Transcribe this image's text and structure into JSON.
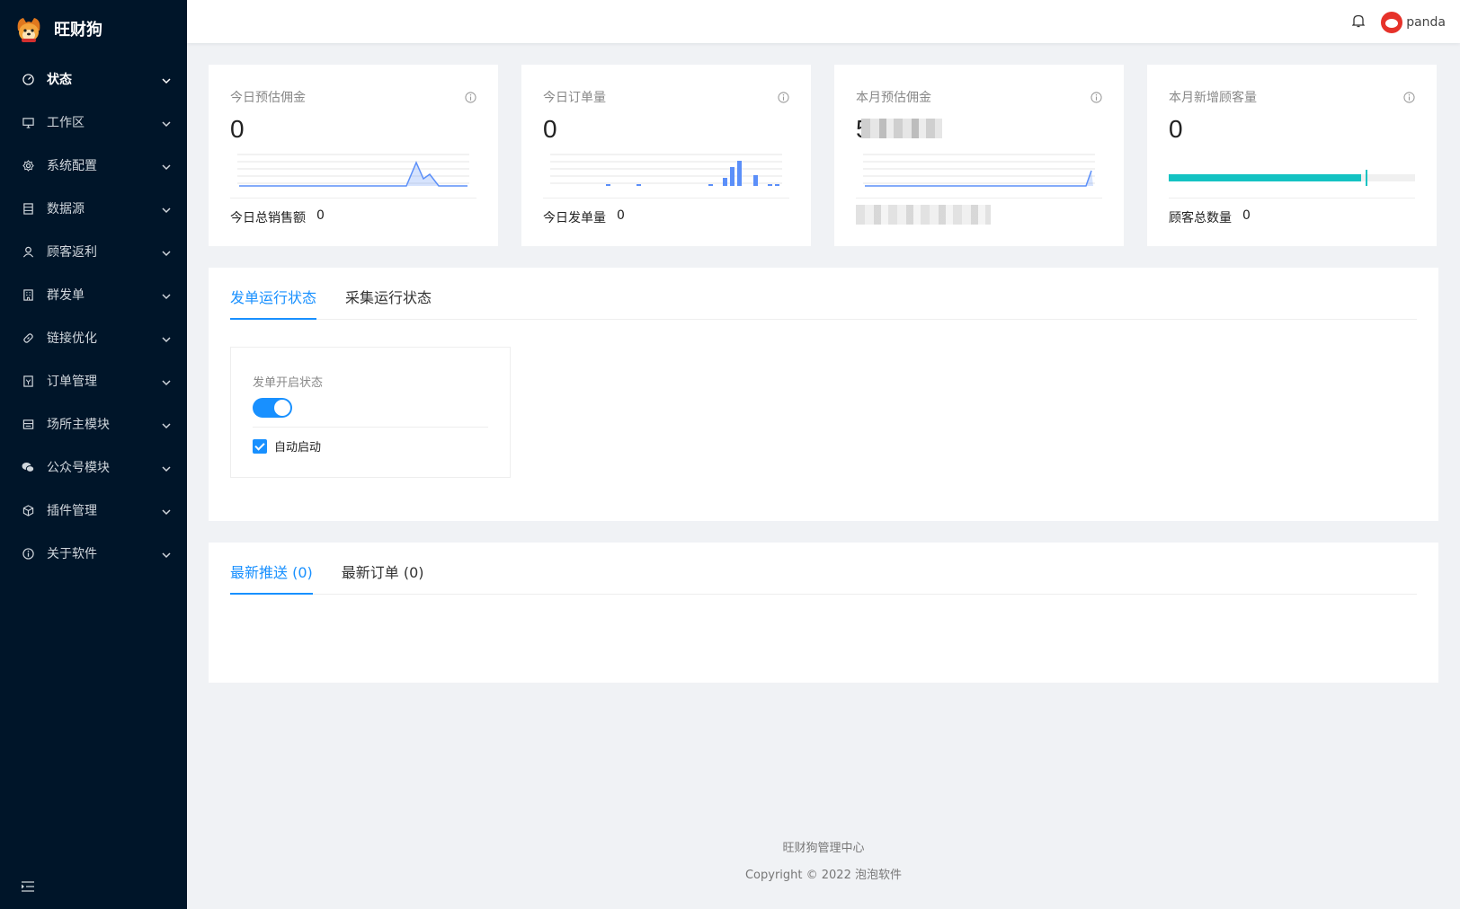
{
  "app": {
    "title": "旺财狗"
  },
  "sidebar": {
    "items": [
      {
        "label": "状态",
        "icon": "dashboard-icon",
        "active": true
      },
      {
        "label": "工作区",
        "icon": "desktop-icon"
      },
      {
        "label": "系统配置",
        "icon": "gear-icon"
      },
      {
        "label": "数据源",
        "icon": "database-icon"
      },
      {
        "label": "顾客返利",
        "icon": "user-icon"
      },
      {
        "label": "群发单",
        "icon": "building-icon"
      },
      {
        "label": "链接优化",
        "icon": "link-icon"
      },
      {
        "label": "订单管理",
        "icon": "order-icon"
      },
      {
        "label": "场所主模块",
        "icon": "store-icon"
      },
      {
        "label": "公众号模块",
        "icon": "wechat-icon"
      },
      {
        "label": "插件管理",
        "icon": "plugin-icon"
      },
      {
        "label": "关于软件",
        "icon": "info-icon"
      }
    ]
  },
  "header": {
    "username": "panda"
  },
  "cards": [
    {
      "title": "今日预估佣金",
      "value": "0",
      "footer_label": "今日总销售额",
      "footer_value": "0"
    },
    {
      "title": "今日订单量",
      "value": "0",
      "footer_label": "今日发单量",
      "footer_value": "0"
    },
    {
      "title": "本月预估佣金",
      "value": "5",
      "footer_label": "",
      "footer_value": ""
    },
    {
      "title": "本月新增顾客量",
      "value": "0",
      "footer_label": "顾客总数量",
      "footer_value": "0",
      "progress_fraction": 0.78,
      "target_fraction": 0.8
    }
  ],
  "status_panel": {
    "tabs": [
      {
        "label": "发单运行状态",
        "active": true
      },
      {
        "label": "采集运行状态"
      }
    ],
    "box_title": "发单开启状态",
    "switch_on": true,
    "checkbox_label": "自动启动",
    "checkbox_checked": true
  },
  "latest_panel": {
    "tabs": [
      {
        "label": "最新推送 (0)",
        "active": true
      },
      {
        "label": "最新订单 (0)"
      }
    ]
  },
  "footer": {
    "line1": "旺财狗管理中心",
    "line2": "Copyright © 2022 泡泡软件"
  },
  "colors": {
    "sidebar_bg": "#001529",
    "accent": "#1890ff",
    "progress": "#13c2c2",
    "chart_line": "#5b8ff9"
  }
}
